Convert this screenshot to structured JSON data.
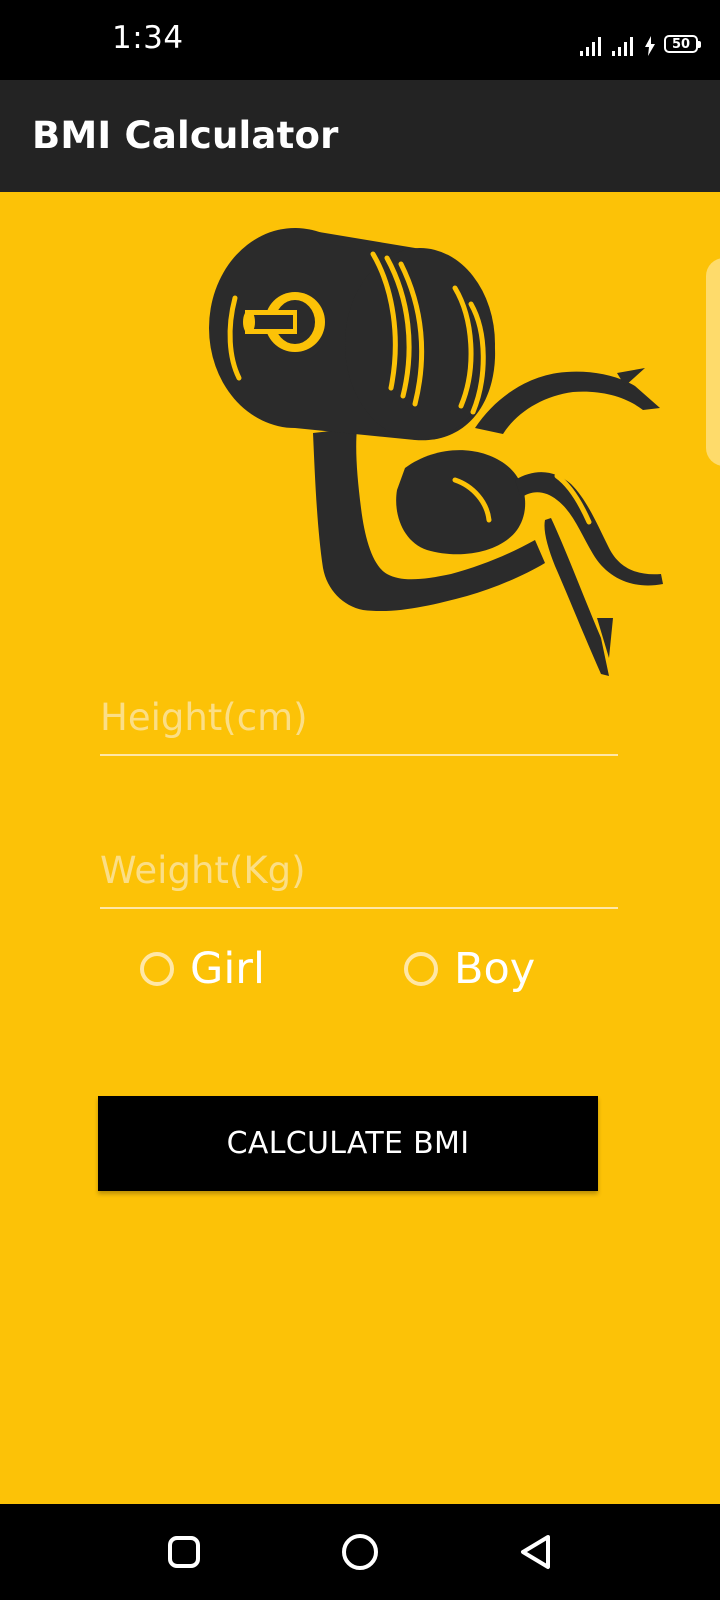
{
  "status_bar": {
    "time": "1:34",
    "battery_level": "50",
    "icons": [
      "signal-icon",
      "signal-icon",
      "charging-icon",
      "battery-icon"
    ]
  },
  "app_bar": {
    "title": "BMI Calculator"
  },
  "hero": {
    "icon": "weightlifting-arm-icon"
  },
  "form": {
    "height": {
      "placeholder": "Height(cm)",
      "value": ""
    },
    "weight": {
      "placeholder": "Weight(Kg)",
      "value": ""
    },
    "gender": {
      "options": [
        {
          "label": "Girl",
          "selected": false
        },
        {
          "label": "Boy",
          "selected": false
        }
      ]
    },
    "calculate_label": "CALCULATE BMI"
  },
  "nav_bar": {
    "buttons": [
      "recents-icon",
      "home-icon",
      "back-icon"
    ]
  },
  "colors": {
    "background": "#FCC207",
    "app_bar": "#232323",
    "illustration": "#2B2B2B",
    "button": "#000000",
    "placeholder": "#FBDE86"
  }
}
